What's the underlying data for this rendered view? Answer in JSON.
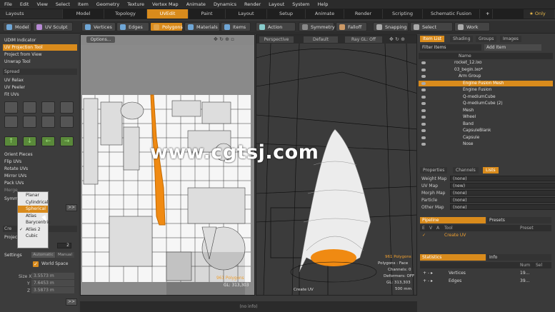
{
  "menubar": [
    "File",
    "Edit",
    "View",
    "Select",
    "Item",
    "Geometry",
    "Texture",
    "Vertex Map",
    "Animate",
    "Dynamics",
    "Render",
    "Layout",
    "System",
    "Help"
  ],
  "tabs": [
    "Layouts",
    "Model",
    "Topology",
    "UVEdit",
    "Paint",
    "Layout",
    "Setup",
    "Animate",
    "Render",
    "Scripting",
    "Schematic Fusion"
  ],
  "tabs_active": 3,
  "tab_plus": "+",
  "only_label": "★ Only",
  "toolbar": {
    "model": "Model",
    "uv_sculpt": "UV Sculpt",
    "vertices": "Vertices",
    "edges": "Edges",
    "polygons": "Polygons",
    "materials": "Materials",
    "items": "Items",
    "action_center": "Action Center",
    "symmetry": "Symmetry",
    "falloff": "Falloff",
    "snapping": "Snapping",
    "select_through": "Select Through",
    "work_plane": "Work Plane"
  },
  "left": {
    "udim": "UDIM Indicator",
    "uv_proj": "UV Projection Tool",
    "proj_view": "Project from View",
    "unwrap": "Unwrap Tool",
    "spread": "Spread",
    "relax": "UV Relax",
    "peeler": "UV Peeler",
    "fit": "Fit UVs",
    "orient": "Orient Pieces",
    "flip": "Flip UVs",
    "rotate": "Rotate UVs",
    "mirror": "Mirror UVs",
    "pack": "Pack UVs",
    "merge": "Merge",
    "symm": "Symm",
    "cre": "Cre",
    "proje": "Projec",
    "settings": "Settings",
    "automatic": "Automatic",
    "manual": "Manual",
    "world_space": "World Space",
    "size_x": "Size X",
    "size_y": "Y",
    "size_z": "Z",
    "sx": "3.5573 m",
    "sy": "7.6453 m",
    "sz": "3.5873 m",
    "n2": "2",
    "more": ">>"
  },
  "popup": [
    "Planar",
    "Cylindrical",
    "Spherical",
    "Atlas",
    "Barycentric",
    "Atlas 2",
    "Cubic"
  ],
  "popup_selected": 2,
  "uvview": {
    "options": "Options...",
    "info1": "961 Polygons",
    "info2": "GL: 313,303"
  },
  "persp": {
    "perspective": "Perspective",
    "default": "Default",
    "raygl": "Ray GL: Off",
    "stats": [
      "961 Polygons",
      "Polygons : Face",
      "Channels: 0",
      "Deformers: OFF",
      "GL: 313,303",
      "500 mm"
    ],
    "create_uv": "Create UV"
  },
  "watermark": "www.cgtsj.com",
  "right": {
    "tabs": [
      "Item List",
      "Shading",
      "Groups",
      "Images"
    ],
    "filter": "Filter Items",
    "add_item": "Add Item",
    "name_col": "Name",
    "items": [
      {
        "name": "rocket_12.lxo",
        "indent": 0,
        "sel": false
      },
      {
        "name": "03_begin.lxo*",
        "indent": 0,
        "sel": false
      },
      {
        "name": "Arm Group",
        "indent": 1,
        "sel": false
      },
      {
        "name": "Engine Fusion Mesh",
        "indent": 2,
        "sel": true
      },
      {
        "name": "Engine Fusion",
        "indent": 2,
        "sel": false
      },
      {
        "name": "Q-mediumCube",
        "indent": 2,
        "sel": false
      },
      {
        "name": "Q-mediumCube (2)",
        "indent": 2,
        "sel": false
      },
      {
        "name": "Mesh",
        "indent": 2,
        "sel": false
      },
      {
        "name": "Wheel",
        "indent": 2,
        "sel": false
      },
      {
        "name": "Band",
        "indent": 2,
        "sel": false
      },
      {
        "name": "CapsuleBlank",
        "indent": 2,
        "sel": false
      },
      {
        "name": "Capsule",
        "indent": 2,
        "sel": false
      },
      {
        "name": "Nose",
        "indent": 2,
        "sel": false
      }
    ],
    "tabs2": [
      "Properties",
      "Channels",
      "Lists"
    ],
    "props": [
      {
        "label": "Weight Map",
        "value": "(none)"
      },
      {
        "label": "UV Map",
        "value": "(new)"
      },
      {
        "label": "Morph Map",
        "value": "(none)"
      },
      {
        "label": "Particle",
        "value": "(none)"
      },
      {
        "label": "Other Map",
        "value": "(none)"
      }
    ],
    "pipeline": "Pipeline",
    "presets": "Presets",
    "en": "E",
    "v": "V",
    "a": "A",
    "tool": "Tool",
    "preset": "Preset",
    "create_uv": "Create UV",
    "statistics": "Statistics",
    "info": "Info",
    "num": "Num",
    "sel": "Sel",
    "stats_rows": [
      {
        "name": "Vertices",
        "num": "19..."
      },
      {
        "name": "Edges",
        "num": "39..."
      }
    ]
  },
  "status": "(no info)"
}
